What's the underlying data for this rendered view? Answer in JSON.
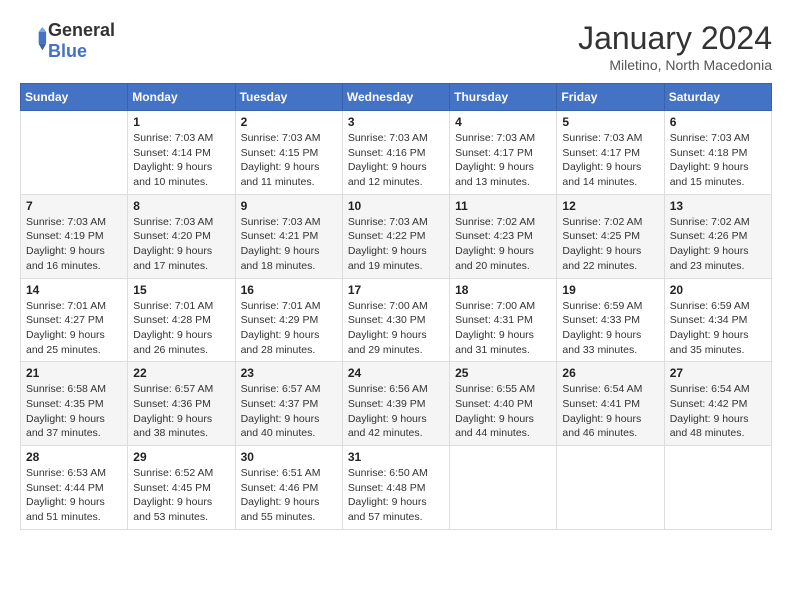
{
  "header": {
    "logo_general": "General",
    "logo_blue": "Blue",
    "title": "January 2024",
    "subtitle": "Miletino, North Macedonia"
  },
  "days_of_week": [
    "Sunday",
    "Monday",
    "Tuesday",
    "Wednesday",
    "Thursday",
    "Friday",
    "Saturday"
  ],
  "weeks": [
    [
      {
        "day": "",
        "sunrise": "",
        "sunset": "",
        "daylight": ""
      },
      {
        "day": "1",
        "sunrise": "Sunrise: 7:03 AM",
        "sunset": "Sunset: 4:14 PM",
        "daylight": "Daylight: 9 hours and 10 minutes."
      },
      {
        "day": "2",
        "sunrise": "Sunrise: 7:03 AM",
        "sunset": "Sunset: 4:15 PM",
        "daylight": "Daylight: 9 hours and 11 minutes."
      },
      {
        "day": "3",
        "sunrise": "Sunrise: 7:03 AM",
        "sunset": "Sunset: 4:16 PM",
        "daylight": "Daylight: 9 hours and 12 minutes."
      },
      {
        "day": "4",
        "sunrise": "Sunrise: 7:03 AM",
        "sunset": "Sunset: 4:17 PM",
        "daylight": "Daylight: 9 hours and 13 minutes."
      },
      {
        "day": "5",
        "sunrise": "Sunrise: 7:03 AM",
        "sunset": "Sunset: 4:17 PM",
        "daylight": "Daylight: 9 hours and 14 minutes."
      },
      {
        "day": "6",
        "sunrise": "Sunrise: 7:03 AM",
        "sunset": "Sunset: 4:18 PM",
        "daylight": "Daylight: 9 hours and 15 minutes."
      }
    ],
    [
      {
        "day": "7",
        "sunrise": "Sunrise: 7:03 AM",
        "sunset": "Sunset: 4:19 PM",
        "daylight": "Daylight: 9 hours and 16 minutes."
      },
      {
        "day": "8",
        "sunrise": "Sunrise: 7:03 AM",
        "sunset": "Sunset: 4:20 PM",
        "daylight": "Daylight: 9 hours and 17 minutes."
      },
      {
        "day": "9",
        "sunrise": "Sunrise: 7:03 AM",
        "sunset": "Sunset: 4:21 PM",
        "daylight": "Daylight: 9 hours and 18 minutes."
      },
      {
        "day": "10",
        "sunrise": "Sunrise: 7:03 AM",
        "sunset": "Sunset: 4:22 PM",
        "daylight": "Daylight: 9 hours and 19 minutes."
      },
      {
        "day": "11",
        "sunrise": "Sunrise: 7:02 AM",
        "sunset": "Sunset: 4:23 PM",
        "daylight": "Daylight: 9 hours and 20 minutes."
      },
      {
        "day": "12",
        "sunrise": "Sunrise: 7:02 AM",
        "sunset": "Sunset: 4:25 PM",
        "daylight": "Daylight: 9 hours and 22 minutes."
      },
      {
        "day": "13",
        "sunrise": "Sunrise: 7:02 AM",
        "sunset": "Sunset: 4:26 PM",
        "daylight": "Daylight: 9 hours and 23 minutes."
      }
    ],
    [
      {
        "day": "14",
        "sunrise": "Sunrise: 7:01 AM",
        "sunset": "Sunset: 4:27 PM",
        "daylight": "Daylight: 9 hours and 25 minutes."
      },
      {
        "day": "15",
        "sunrise": "Sunrise: 7:01 AM",
        "sunset": "Sunset: 4:28 PM",
        "daylight": "Daylight: 9 hours and 26 minutes."
      },
      {
        "day": "16",
        "sunrise": "Sunrise: 7:01 AM",
        "sunset": "Sunset: 4:29 PM",
        "daylight": "Daylight: 9 hours and 28 minutes."
      },
      {
        "day": "17",
        "sunrise": "Sunrise: 7:00 AM",
        "sunset": "Sunset: 4:30 PM",
        "daylight": "Daylight: 9 hours and 29 minutes."
      },
      {
        "day": "18",
        "sunrise": "Sunrise: 7:00 AM",
        "sunset": "Sunset: 4:31 PM",
        "daylight": "Daylight: 9 hours and 31 minutes."
      },
      {
        "day": "19",
        "sunrise": "Sunrise: 6:59 AM",
        "sunset": "Sunset: 4:33 PM",
        "daylight": "Daylight: 9 hours and 33 minutes."
      },
      {
        "day": "20",
        "sunrise": "Sunrise: 6:59 AM",
        "sunset": "Sunset: 4:34 PM",
        "daylight": "Daylight: 9 hours and 35 minutes."
      }
    ],
    [
      {
        "day": "21",
        "sunrise": "Sunrise: 6:58 AM",
        "sunset": "Sunset: 4:35 PM",
        "daylight": "Daylight: 9 hours and 37 minutes."
      },
      {
        "day": "22",
        "sunrise": "Sunrise: 6:57 AM",
        "sunset": "Sunset: 4:36 PM",
        "daylight": "Daylight: 9 hours and 38 minutes."
      },
      {
        "day": "23",
        "sunrise": "Sunrise: 6:57 AM",
        "sunset": "Sunset: 4:37 PM",
        "daylight": "Daylight: 9 hours and 40 minutes."
      },
      {
        "day": "24",
        "sunrise": "Sunrise: 6:56 AM",
        "sunset": "Sunset: 4:39 PM",
        "daylight": "Daylight: 9 hours and 42 minutes."
      },
      {
        "day": "25",
        "sunrise": "Sunrise: 6:55 AM",
        "sunset": "Sunset: 4:40 PM",
        "daylight": "Daylight: 9 hours and 44 minutes."
      },
      {
        "day": "26",
        "sunrise": "Sunrise: 6:54 AM",
        "sunset": "Sunset: 4:41 PM",
        "daylight": "Daylight: 9 hours and 46 minutes."
      },
      {
        "day": "27",
        "sunrise": "Sunrise: 6:54 AM",
        "sunset": "Sunset: 4:42 PM",
        "daylight": "Daylight: 9 hours and 48 minutes."
      }
    ],
    [
      {
        "day": "28",
        "sunrise": "Sunrise: 6:53 AM",
        "sunset": "Sunset: 4:44 PM",
        "daylight": "Daylight: 9 hours and 51 minutes."
      },
      {
        "day": "29",
        "sunrise": "Sunrise: 6:52 AM",
        "sunset": "Sunset: 4:45 PM",
        "daylight": "Daylight: 9 hours and 53 minutes."
      },
      {
        "day": "30",
        "sunrise": "Sunrise: 6:51 AM",
        "sunset": "Sunset: 4:46 PM",
        "daylight": "Daylight: 9 hours and 55 minutes."
      },
      {
        "day": "31",
        "sunrise": "Sunrise: 6:50 AM",
        "sunset": "Sunset: 4:48 PM",
        "daylight": "Daylight: 9 hours and 57 minutes."
      },
      {
        "day": "",
        "sunrise": "",
        "sunset": "",
        "daylight": ""
      },
      {
        "day": "",
        "sunrise": "",
        "sunset": "",
        "daylight": ""
      },
      {
        "day": "",
        "sunrise": "",
        "sunset": "",
        "daylight": ""
      }
    ]
  ]
}
